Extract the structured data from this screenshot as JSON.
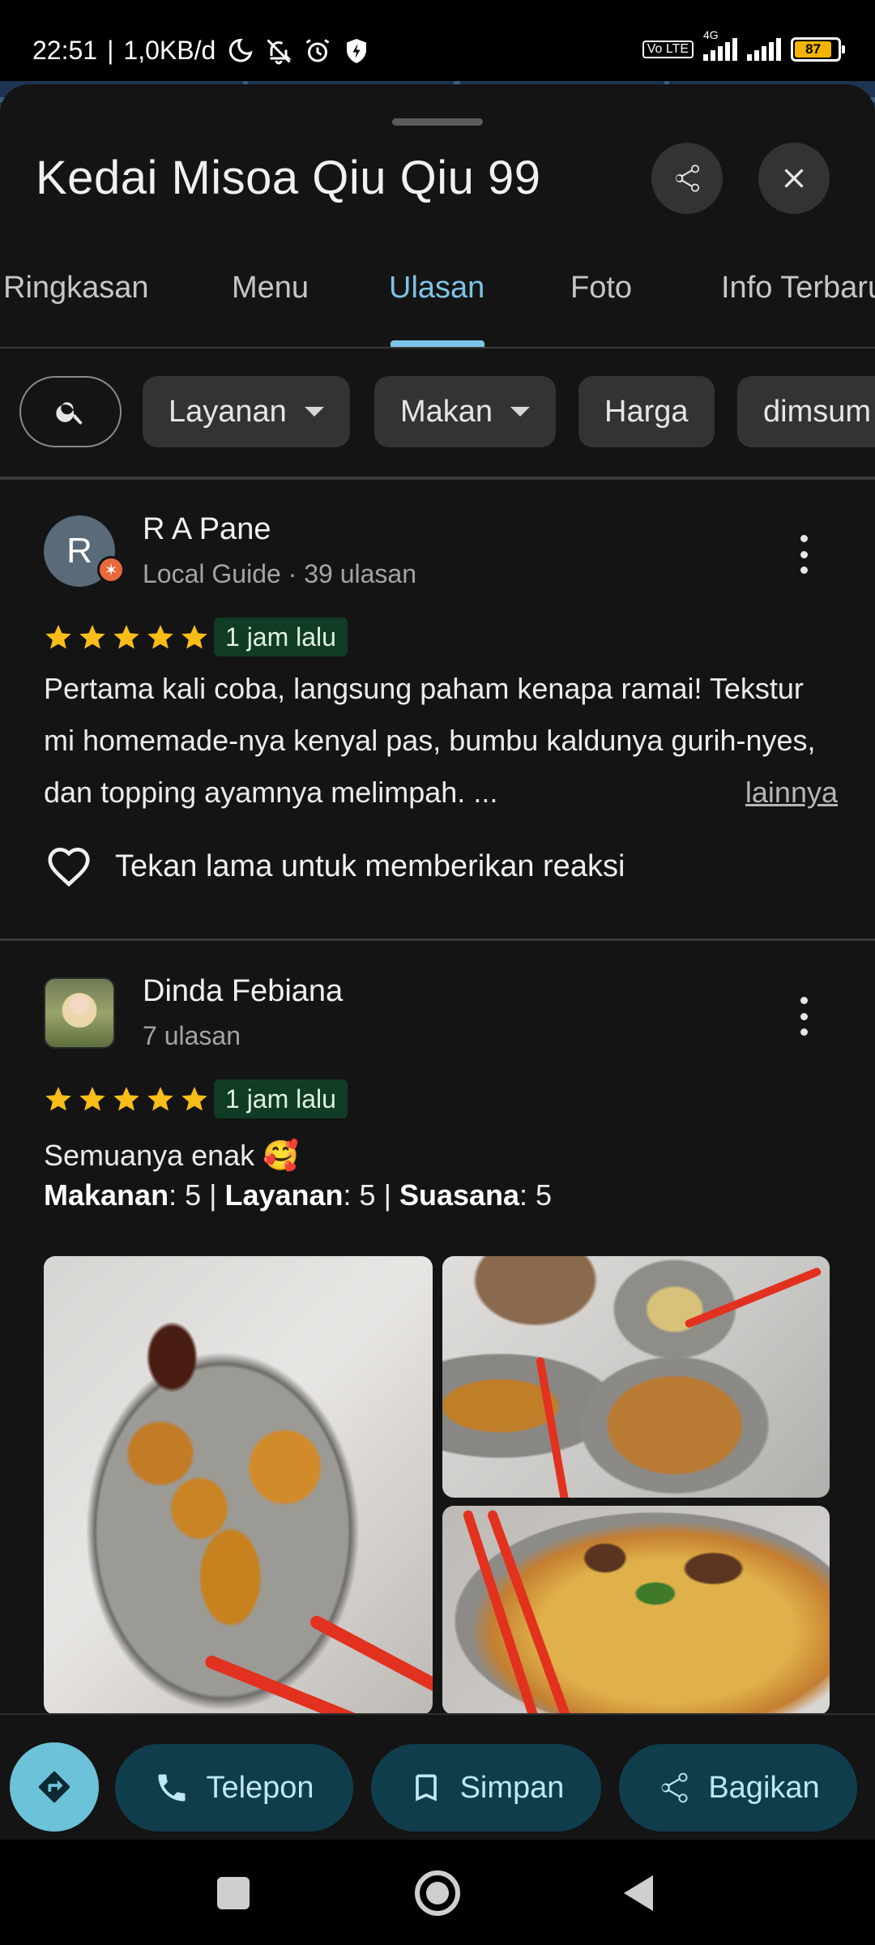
{
  "status_bar": {
    "time": "22:51",
    "speed": "1,0KB/d",
    "volte": "Vo LTE",
    "network": "4G",
    "battery": "87",
    "icons": [
      "moon-icon",
      "bell-off-icon",
      "alarm-icon",
      "shield-icon",
      "signal-icon",
      "battery-icon"
    ]
  },
  "place": {
    "title": "Kedai Misoa Qiu Qiu 99"
  },
  "tabs": [
    {
      "label": "Ringkasan"
    },
    {
      "label": "Menu"
    },
    {
      "label": "Ulasan",
      "active": true
    },
    {
      "label": "Foto"
    },
    {
      "label": "Info Terbaru"
    }
  ],
  "filters": [
    {
      "label": "Layanan",
      "has_dropdown": true
    },
    {
      "label": "Makan",
      "has_dropdown": true
    },
    {
      "label": "Harga",
      "has_dropdown": false
    },
    {
      "label": "dimsum",
      "has_dropdown": false
    }
  ],
  "reviews": [
    {
      "avatar_letter": "R",
      "name": "R A Pane",
      "meta": "Local Guide · 39 ulasan",
      "rating": 5,
      "time": "1 jam lalu",
      "text": "Pertama kali coba, langsung paham kenapa ramai! Tekstur mi homemade-nya kenyal pas, bumbu kaldunya gurih-nyes, dan topping ayamnya melimpah. ...",
      "more_label": "lainnya",
      "reaction_label": "Tekan lama untuk memberikan reaksi"
    },
    {
      "name": "Dinda Febiana",
      "meta": "7 ulasan",
      "rating": 5,
      "time": "1 jam lalu",
      "text": "Semuanya enak 🥰",
      "scores": [
        {
          "label": "Makanan",
          "value": "5"
        },
        {
          "label": "Layanan",
          "value": "5"
        },
        {
          "label": "Suasana",
          "value": "5"
        }
      ]
    }
  ],
  "actions": {
    "call_label": "Telepon",
    "save_label": "Simpan",
    "share_label": "Bagikan"
  },
  "colors": {
    "accent": "#7cc4e6",
    "star": "#f8bd18",
    "action_bg": "#0f3d4c",
    "directions": "#6cc2d8"
  }
}
